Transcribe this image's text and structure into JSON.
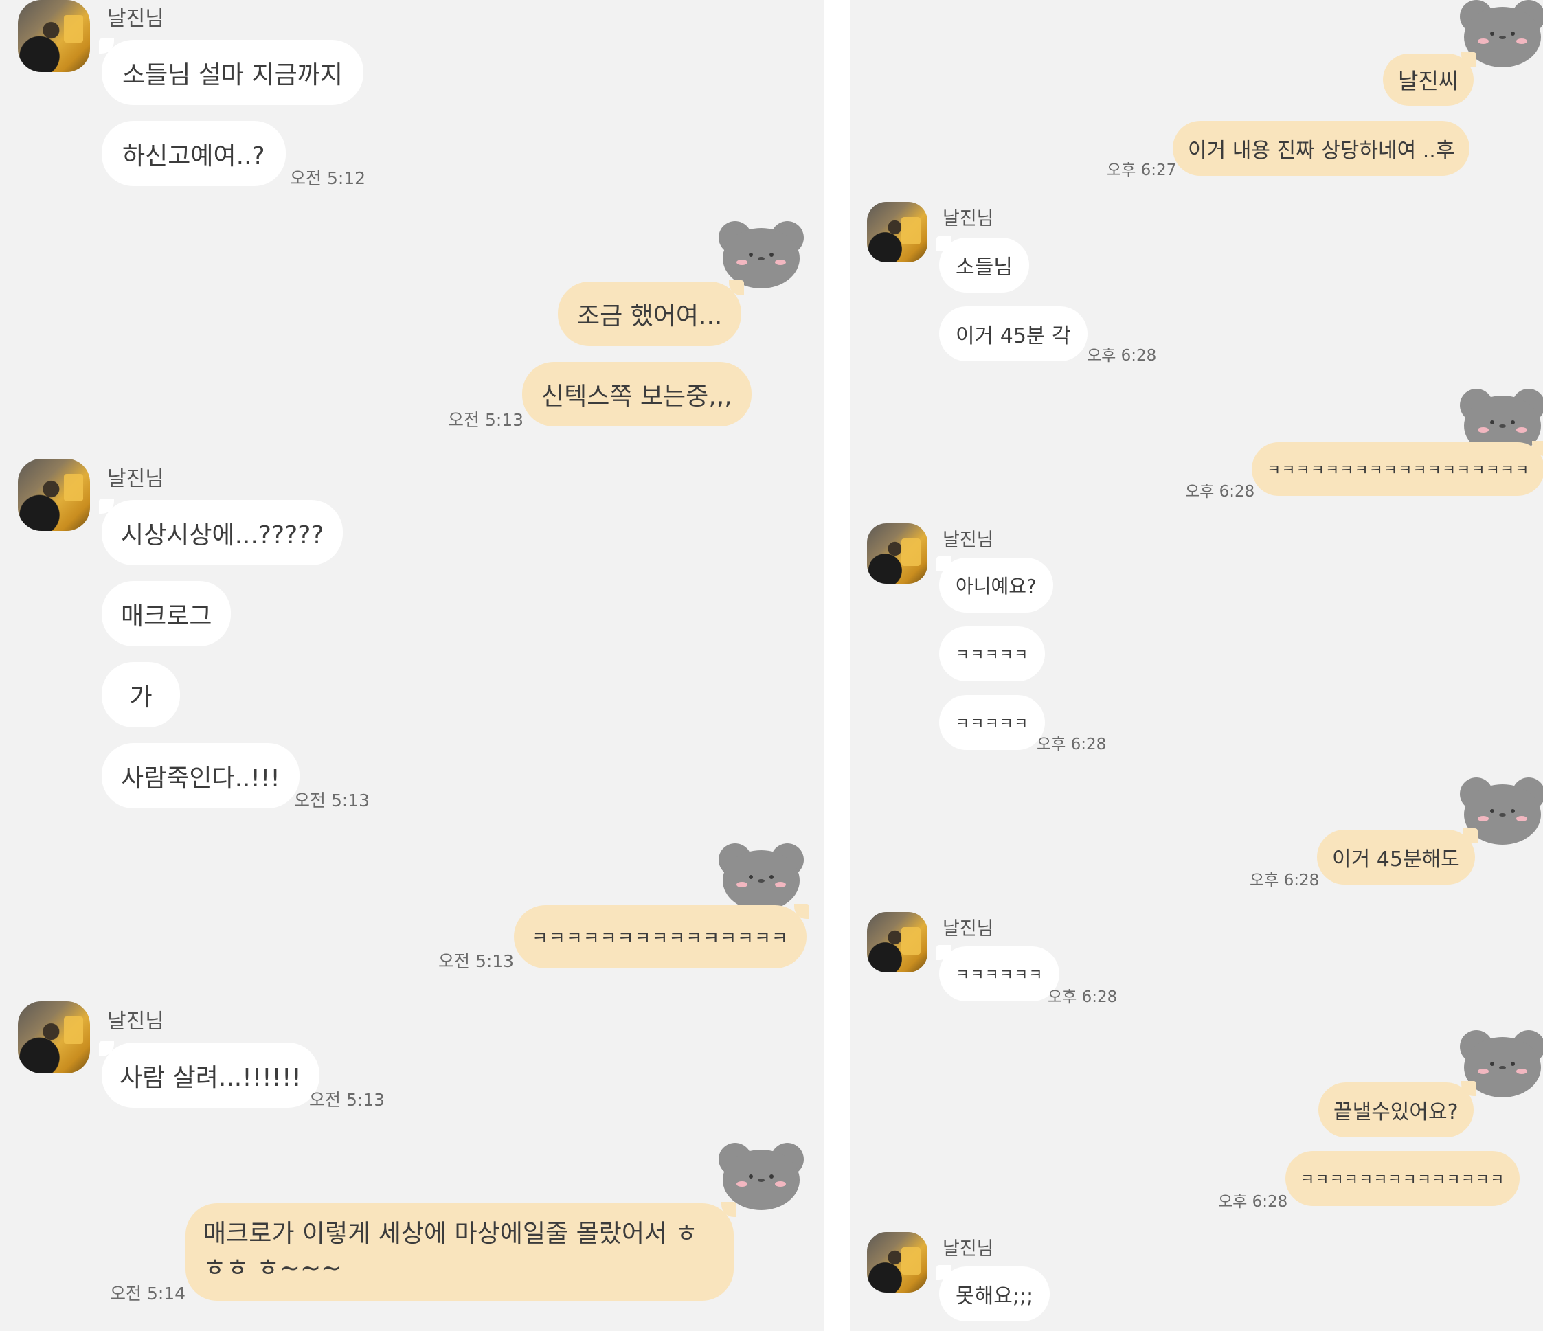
{
  "left": {
    "sender_1": "날진님",
    "msg_1": "소들님 설마 지금까지",
    "msg_2": "하신고예여..?",
    "time_1": "오전 5:12",
    "reply_1": "조금 했어여...",
    "reply_2": "신텍스쪽 보는중,,,",
    "time_2": "오전 5:13",
    "sender_2": "날진님",
    "msg_3": "시상시상에...?????",
    "msg_4": "매크로그",
    "msg_5": "가",
    "msg_6": "사람죽인다..!!!",
    "time_3": "오전 5:13",
    "reply_3": "ㅋㅋㅋㅋㅋㅋㅋㅋㅋㅋㅋㅋㅋㅋㅋ",
    "time_4": "오전 5:13",
    "sender_3": "날진님",
    "msg_7": "사람 살려...!!!!!!",
    "time_5": "오전 5:13",
    "reply_4": "매크로가 이렇게 세상에 마상에일줄 몰랐어서 ㅎㅎㅎ ㅎ~~~",
    "time_6": "오전 5:14"
  },
  "right": {
    "reply_1": "날진씨",
    "reply_2": "이거 내용 진짜 상당하네여 ..후",
    "time_1": "오후 6:27",
    "sender_1": "날진님",
    "msg_1": "소들님",
    "msg_2": "이거 45분 각",
    "time_2": "오후 6:28",
    "reply_3": "ㅋㅋㅋㅋㅋㅋㅋㅋㅋㅋㅋㅋㅋㅋㅋㅋㅋㅋ",
    "time_3": "오후 6:28",
    "sender_2": "날진님",
    "msg_3": "아니예요?",
    "msg_4": "ㅋㅋㅋㅋㅋ",
    "msg_5": "ㅋㅋㅋㅋㅋ",
    "time_4": "오후 6:28",
    "reply_4": "이거 45분해도",
    "time_5": "오후 6:28",
    "sender_3": "날진님",
    "msg_6": "ㅋㅋㅋㅋㅋㅋ",
    "time_6": "오후 6:28",
    "reply_5": "끝낼수있어요?",
    "reply_6": "ㅋㅋㅋㅋㅋㅋㅋㅋㅋㅋㅋㅋㅋㅋ",
    "time_7": "오후 6:28",
    "sender_4": "날진님",
    "msg_7": "못해요;;;"
  },
  "icons": {
    "my_avatar": "gray-bear-icon",
    "partner_avatar": "profile-photo"
  },
  "colors": {
    "background": "#f2f2f2",
    "incoming_bubble": "#ffffff",
    "outgoing_bubble": "#f9e4bd"
  }
}
